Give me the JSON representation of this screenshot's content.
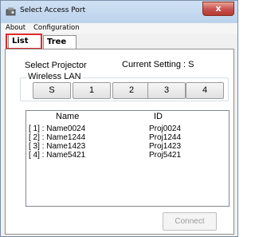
{
  "window": {
    "title": "Select Access Port",
    "close_glyph": "x"
  },
  "menu": {
    "items": [
      {
        "label": "About"
      },
      {
        "label": "Configuration"
      }
    ]
  },
  "tabs": [
    {
      "label": "List",
      "selected": true
    },
    {
      "label": "Tree",
      "selected": false
    }
  ],
  "projector": {
    "select_label": "Select Projector",
    "current_setting_label": "Current Setting : S"
  },
  "wireless_lan": {
    "label": "Wireless LAN",
    "buttons": [
      "S",
      "1",
      "2",
      "3",
      "4"
    ]
  },
  "list": {
    "headers": {
      "name": "Name",
      "id": "ID"
    },
    "rows": [
      {
        "name": "[ 1] : Name0024",
        "id": "Proj0024"
      },
      {
        "name": "[ 2] : Name1244",
        "id": "Proj1244"
      },
      {
        "name": "[ 3] : Name1423",
        "id": "Proj1423"
      },
      {
        "name": "[ 4] : Name5421",
        "id": "Proj5421"
      }
    ]
  },
  "connect_button": {
    "label": "Connect",
    "enabled": false
  },
  "colors": {
    "highlight_border": "#e1282b",
    "close_button": "#c75050",
    "disabled_text": "#9c9c9c"
  }
}
